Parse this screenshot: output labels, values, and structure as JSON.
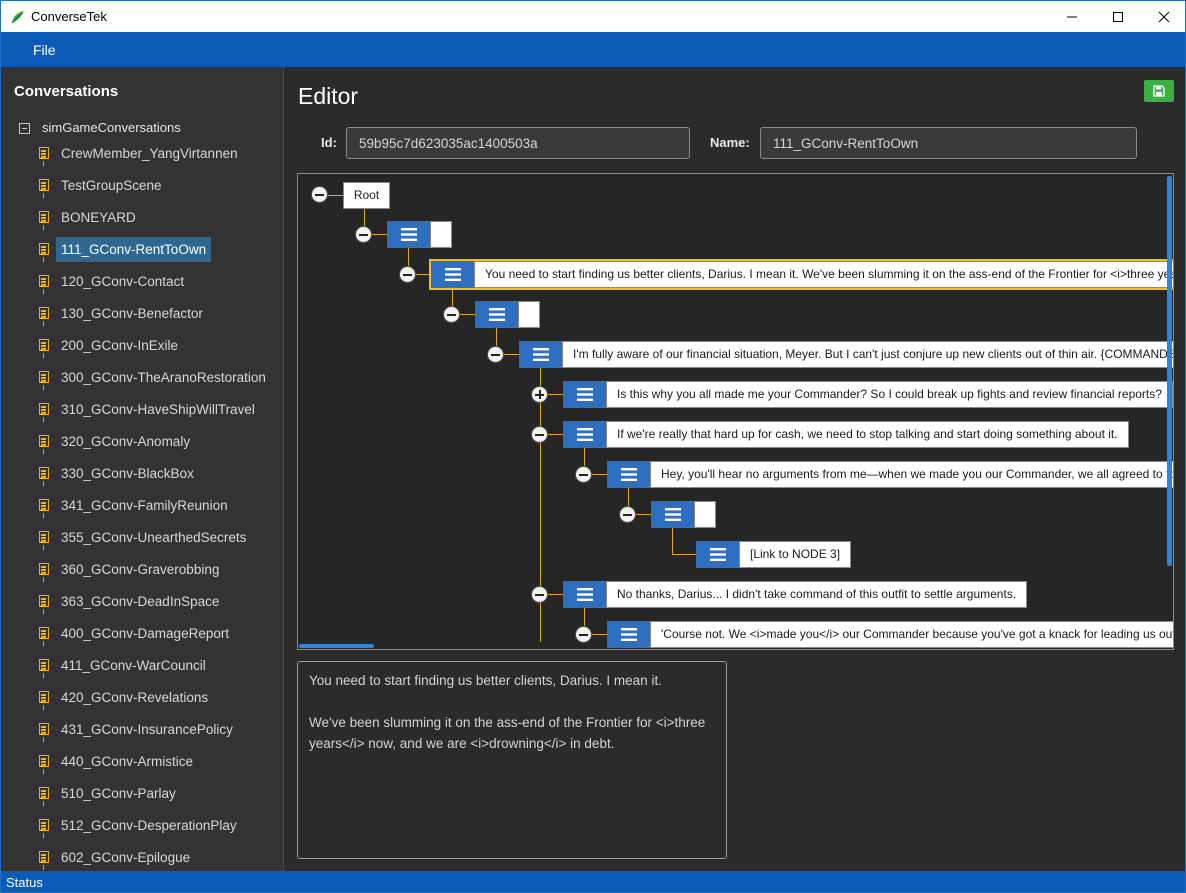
{
  "window": {
    "title": "ConverseTek"
  },
  "menu": {
    "file_label": "File"
  },
  "sidebar": {
    "title": "Conversations",
    "root_label": "simGameConversations",
    "items": [
      {
        "label": "CrewMember_YangVirtannen",
        "selected": false
      },
      {
        "label": "TestGroupScene",
        "selected": false
      },
      {
        "label": "BONEYARD",
        "selected": false
      },
      {
        "label": "111_GConv-RentToOwn",
        "selected": true
      },
      {
        "label": "120_GConv-Contact",
        "selected": false
      },
      {
        "label": "130_GConv-Benefactor",
        "selected": false
      },
      {
        "label": "200_GConv-InExile",
        "selected": false
      },
      {
        "label": "300_GConv-TheAranoRestoration",
        "selected": false
      },
      {
        "label": "310_GConv-HaveShipWillTravel",
        "selected": false
      },
      {
        "label": "320_GConv-Anomaly",
        "selected": false
      },
      {
        "label": "330_GConv-BlackBox",
        "selected": false
      },
      {
        "label": "341_GConv-FamilyReunion",
        "selected": false
      },
      {
        "label": "355_GConv-UnearthedSecrets",
        "selected": false
      },
      {
        "label": "360_GConv-Graverobbing",
        "selected": false
      },
      {
        "label": "363_GConv-DeadInSpace",
        "selected": false
      },
      {
        "label": "400_GConv-DamageReport",
        "selected": false
      },
      {
        "label": "411_GConv-WarCouncil",
        "selected": false
      },
      {
        "label": "420_GConv-Revelations",
        "selected": false
      },
      {
        "label": "431_GConv-InsurancePolicy",
        "selected": false
      },
      {
        "label": "440_GConv-Armistice",
        "selected": false
      },
      {
        "label": "510_GConv-Parlay",
        "selected": false
      },
      {
        "label": "512_GConv-DesperationPlay",
        "selected": false
      },
      {
        "label": "602_GConv-Epilogue",
        "selected": false
      }
    ]
  },
  "editor": {
    "title": "Editor",
    "id_label": "Id",
    "id_value": "59b95c7d623035ac1400503a",
    "name_label": "Name",
    "name_value": "111_GConv-RentToOwn"
  },
  "graph": {
    "root_label": "Root",
    "nodes": [
      {
        "text": ""
      },
      {
        "text": "You need to start finding us better clients, Darius. I mean it. We've been slumming it on the ass-end of the Frontier for <i>three years</i> now, and we are <i>drowning</i> in debt."
      },
      {
        "text": ""
      },
      {
        "text": "I'm fully aware of our financial situation, Meyer. But I can't just conjure up new clients out of thin air. {COMMANDER.FirstName}"
      },
      {
        "text": "Is this why you all made me your Commander? So I could break up fights and review financial reports?"
      },
      {
        "text": "If we're really that hard up for cash, we need to stop talking and start doing something about it."
      },
      {
        "text": "Hey, you'll hear no arguments from me—when we made you our Commander, we all agreed to follow your lead."
      },
      {
        "text": ""
      },
      {
        "text": "[Link to NODE 3]"
      },
      {
        "text": "No thanks, Darius... I didn't take command of this outfit to settle arguments."
      },
      {
        "text": "'Course not. We <i>made you</i> our Commander because you've got a knack for leading us out of trouble."
      }
    ]
  },
  "preview": {
    "text": "You need to start finding us better clients, Darius. I mean it.\n\nWe've been slumming it on the ass-end of the Frontier for <i>three years</i> now, and we are <i>drowning</i> in debt."
  },
  "status": {
    "text": "Status"
  }
}
